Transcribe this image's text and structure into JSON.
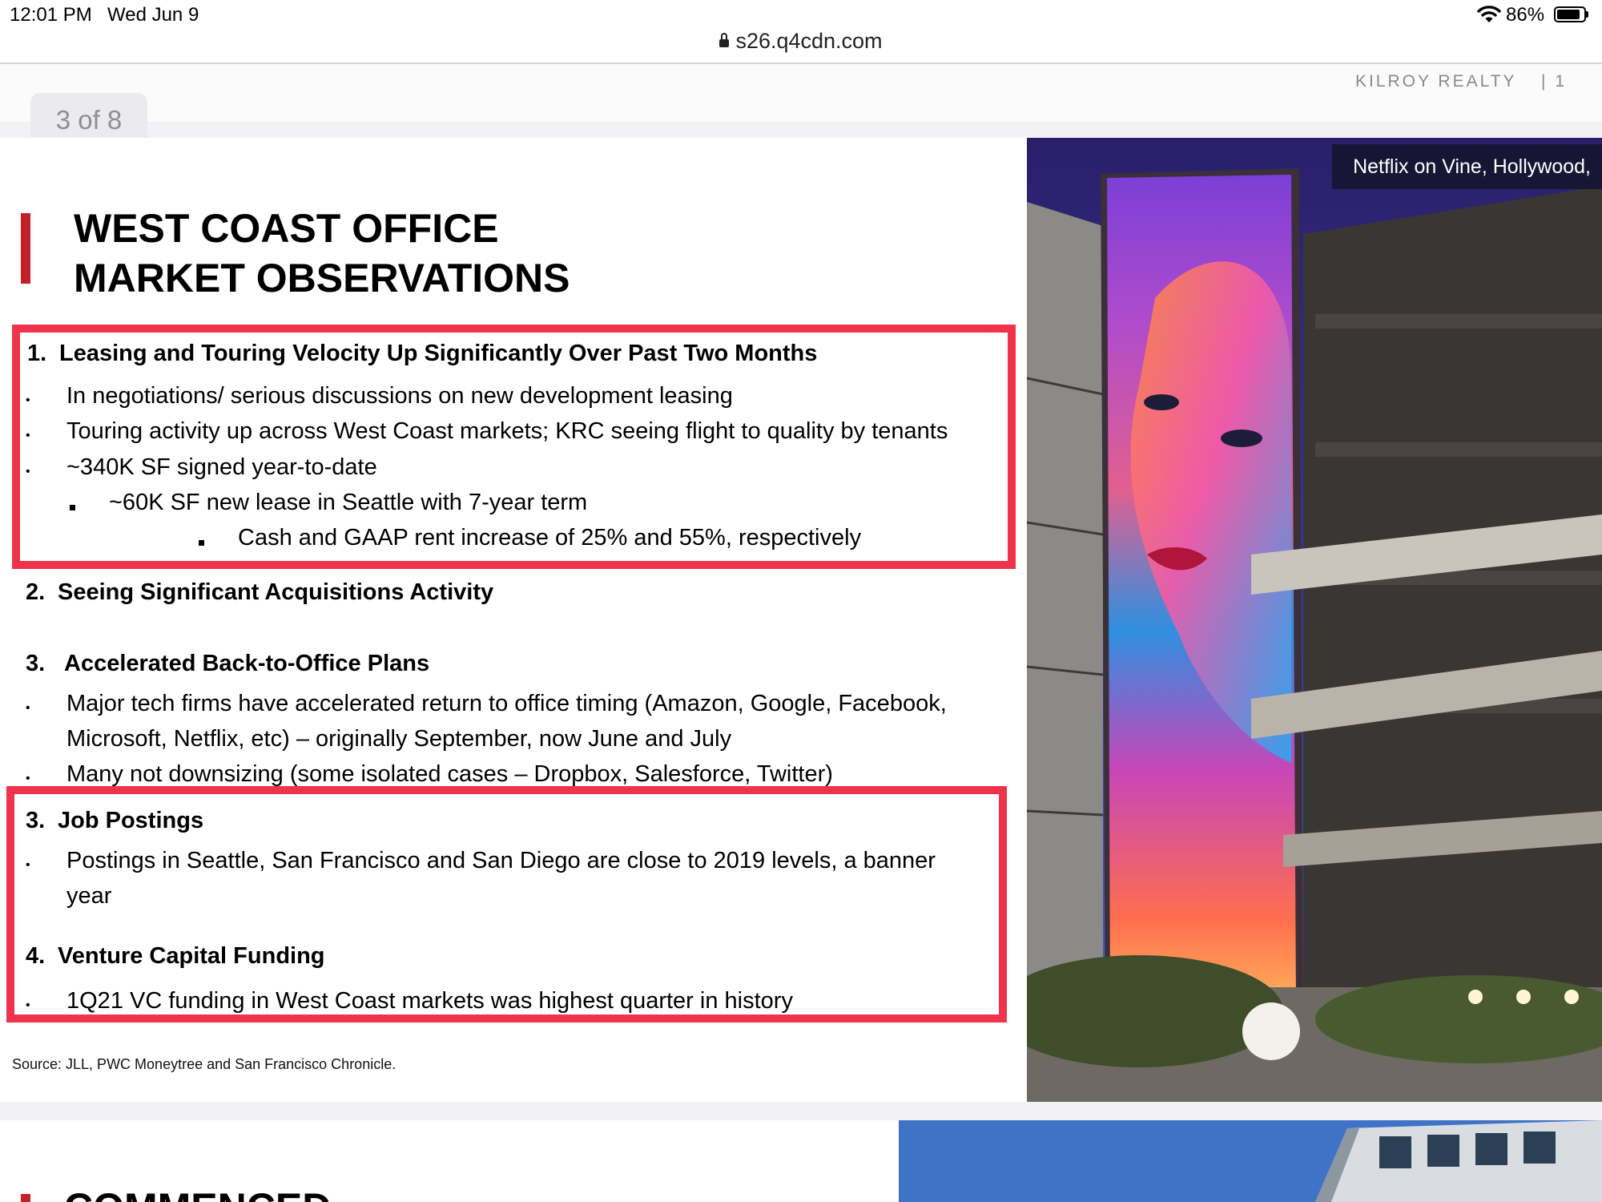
{
  "status_bar": {
    "time": "12:01 PM",
    "date": "Wed Jun 9",
    "battery": "86%",
    "battery_level": 0.86
  },
  "address_bar": {
    "url": "s26.q4cdn.com"
  },
  "page_header": {
    "brand": "KILROY REALTY",
    "page_number": "| 1",
    "page_indicator": "3 of 8"
  },
  "slide": {
    "title_line1": "WEST COAST OFFICE",
    "title_line2": "MARKET OBSERVATIONS",
    "photo_caption": "Netflix on Vine, Hollywood,",
    "sections": {
      "s1": {
        "number": "1.",
        "heading": "Leasing and Touring Velocity Up Significantly Over Past Two Months",
        "bullets": [
          "In negotiations/ serious discussions on new development leasing",
          "Touring activity up across West Coast markets; KRC seeing flight to quality by tenants",
          "~340K SF signed year-to-date"
        ],
        "sub_bullet": "~60K SF new lease in Seattle with 7-year term",
        "sub_sub_bullet": "Cash and GAAP rent increase of 25% and 55%, respectively"
      },
      "s2": {
        "number": "2.",
        "heading": "Seeing Significant Acquisitions Activity"
      },
      "s3": {
        "number": "3.",
        "heading": "Accelerated Back-to-Office Plans",
        "bullet1_line1": "Major tech firms have accelerated return to office timing (Amazon, Google, Facebook,",
        "bullet1_line2": "Microsoft, Netflix, etc) – originally September, now June and July",
        "bullet2": "Many not downsizing (some isolated cases – Dropbox, Salesforce, Twitter)"
      },
      "s4": {
        "number": "3.",
        "heading": "Job Postings",
        "bullet_line1": "Postings in Seattle, San Francisco and San Diego are close to 2019 levels, a banner",
        "bullet_line2": "year"
      },
      "s5": {
        "number": "4.",
        "heading": "Venture Capital Funding",
        "bullet": "1Q21 VC funding in West Coast markets was highest quarter in history"
      }
    },
    "source": "Source: JLL, PWC Moneytree and San Francisco Chronicle."
  },
  "next_slide": {
    "title_partial": "COMMENCED"
  },
  "colors": {
    "annotation_frame": "#f0334c",
    "accent_bar": "#c42127"
  }
}
